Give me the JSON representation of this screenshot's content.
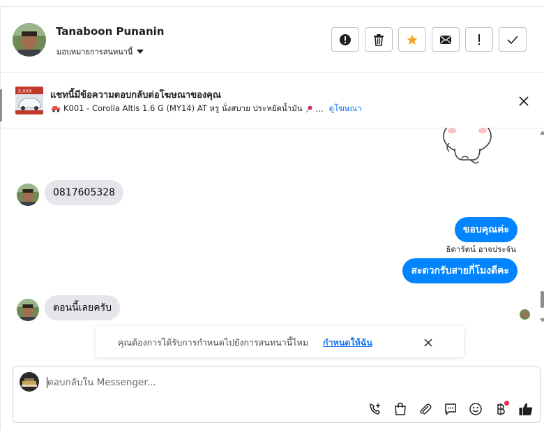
{
  "header": {
    "contact_name": "Tanaboon Punanin",
    "assign_label": "มอบหมายการสนทนานี้",
    "actions": [
      {
        "icon": "alert-circle-icon"
      },
      {
        "icon": "trash-icon"
      },
      {
        "icon": "star-icon",
        "color": "#f5a623"
      },
      {
        "icon": "envelope-icon"
      },
      {
        "icon": "exclamation-icon"
      },
      {
        "icon": "check-icon"
      }
    ]
  },
  "ad_banner": {
    "title": "แชทนี้มีข้อความตอบกลับต่อโฆษณาของคุณ",
    "subtitle": "K001 - Corolla Altis 1.6 G (MY14) AT หรู นั่งสบาย ประหยัดน้ำมัน",
    "ellipsis": "...",
    "link_label": "ดูโฆษณา",
    "thumb_badge": "5,XXX"
  },
  "messages": [
    {
      "direction": "in",
      "text": "0817605328"
    },
    {
      "direction": "out",
      "text": "ขอบคุณค่ะ"
    },
    {
      "direction": "out_name",
      "text": "ธิดารัตน์ อาจประจัน"
    },
    {
      "direction": "out",
      "text": "สะดวกรับสายกี่โมงดีคะ"
    },
    {
      "direction": "in",
      "text": "ตอนนี้เลยครับ"
    }
  ],
  "toast": {
    "text": "คุณต้องการได้รับการกำหนดไปยังการสนทนานี้ไหม",
    "link_label": "กำหนดให้ฉัน"
  },
  "composer": {
    "placeholder": "ตอบกลับใน Messenger...",
    "tools": [
      "add-call-icon",
      "shopping-bag-icon",
      "paperclip-icon",
      "speech-bubble-icon",
      "smiley-icon",
      "baht-icon",
      "thumbs-up-icon"
    ],
    "accent": "#1c1e21",
    "notification_dot_color": "#f02849"
  },
  "colors": {
    "outgoing_bubble": "#0084ff",
    "incoming_bubble": "#e4e6eb",
    "link": "#1877f2"
  }
}
